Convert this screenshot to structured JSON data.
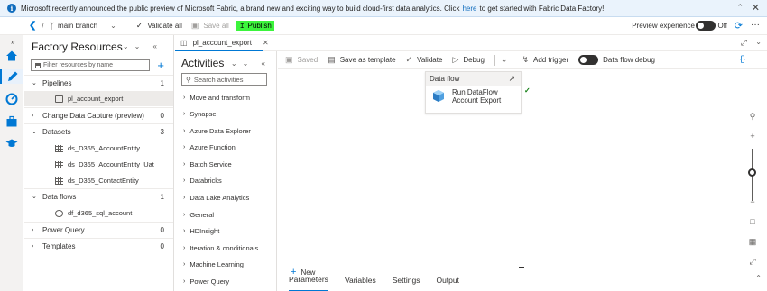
{
  "banner": {
    "text_before": "Microsoft recently announced the public preview of Microsoft Fabric, a brand new and exciting way to build cloud-first data analytics. Click",
    "link": "here",
    "text_after": "to get started with Fabric Data Factory!"
  },
  "topbar": {
    "branch": "main branch",
    "validate_all": "Validate all",
    "save_all": "Save all",
    "publish": "Publish",
    "preview_label": "Preview experience",
    "preview_state": "Off"
  },
  "factory": {
    "title": "Factory Resources",
    "filter_placeholder": "Filter resources by name",
    "sections": [
      {
        "label": "Pipelines",
        "count": "1",
        "items": [
          "pl_account_export"
        ]
      },
      {
        "label": "Change Data Capture (preview)",
        "count": "0",
        "items": []
      },
      {
        "label": "Datasets",
        "count": "3",
        "items": [
          "ds_D365_AccountEntity",
          "ds_D365_AccountEntity_Uat",
          "ds_D365_ContactEntity"
        ]
      },
      {
        "label": "Data flows",
        "count": "1",
        "items": [
          "df_d365_sql_account"
        ]
      },
      {
        "label": "Power Query",
        "count": "0",
        "items": []
      },
      {
        "label": "Templates",
        "count": "0",
        "items": []
      }
    ]
  },
  "editor": {
    "tab_label": "pl_account_export"
  },
  "activities": {
    "title": "Activities",
    "search_placeholder": "Search activities",
    "items": [
      "Move and transform",
      "Synapse",
      "Azure Data Explorer",
      "Azure Function",
      "Batch Service",
      "Databricks",
      "Data Lake Analytics",
      "General",
      "HDInsight",
      "Iteration & conditionals",
      "Machine Learning",
      "Power Query"
    ]
  },
  "pipeline_toolbar": {
    "saved": "Saved",
    "save_as_template": "Save as template",
    "validate": "Validate",
    "debug": "Debug",
    "add_trigger": "Add trigger",
    "data_flow_debug": "Data flow debug"
  },
  "canvas": {
    "node_header": "Data flow",
    "node_line1": "Run DataFlow",
    "node_line2": "Account Export"
  },
  "bottom": {
    "tabs": [
      "Parameters",
      "Variables",
      "Settings",
      "Output"
    ],
    "new_label": "New"
  },
  "colors": {
    "accent": "#0078d4",
    "publish_highlight": "#3cf43c",
    "banner_bg": "#eaf3fc"
  }
}
